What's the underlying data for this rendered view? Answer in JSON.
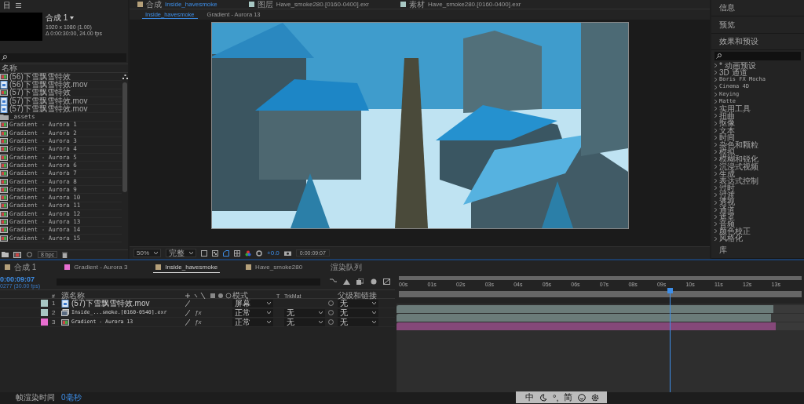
{
  "project": {
    "title": "目",
    "comp_name": "合成 1",
    "comp_size": "1920 x 1080 (1.00)",
    "comp_duration": "Δ 0:00:30:00, 24.00 fps",
    "column": "名称",
    "bpc": "8 bpc",
    "items": [
      {
        "name": "(56)下雪飘雪特效",
        "kind": "comp"
      },
      {
        "name": "(56)下雪飘雪特效.mov",
        "kind": "footage"
      },
      {
        "name": "(57)下雪飘雪特效",
        "kind": "comp"
      },
      {
        "name": "(57)下雪飘雪特效.mov",
        "kind": "footage"
      },
      {
        "name": "(57)下雪飘雪特效.mov",
        "kind": "footage"
      },
      {
        "name": "_assets",
        "kind": "folder"
      },
      {
        "name": "Gradient - Aurora 1",
        "kind": "comp"
      },
      {
        "name": "Gradient - Aurora 2",
        "kind": "comp"
      },
      {
        "name": "Gradient - Aurora 3",
        "kind": "comp"
      },
      {
        "name": "Gradient - Aurora 4",
        "kind": "comp"
      },
      {
        "name": "Gradient - Aurora 5",
        "kind": "comp"
      },
      {
        "name": "Gradient - Aurora 6",
        "kind": "comp"
      },
      {
        "name": "Gradient - Aurora 7",
        "kind": "comp"
      },
      {
        "name": "Gradient - Aurora 8",
        "kind": "comp"
      },
      {
        "name": "Gradient - Aurora 9",
        "kind": "comp"
      },
      {
        "name": "Gradient - Aurora 10",
        "kind": "comp"
      },
      {
        "name": "Gradient - Aurora 11",
        "kind": "comp"
      },
      {
        "name": "Gradient - Aurora 12",
        "kind": "comp"
      },
      {
        "name": "Gradient - Aurora 13",
        "kind": "comp"
      },
      {
        "name": "Gradient - Aurora 14",
        "kind": "comp"
      },
      {
        "name": "Gradient - Aurora 15",
        "kind": "comp"
      }
    ]
  },
  "viewer": {
    "tabs": [
      {
        "prefix": "合成",
        "label": "Inside_havesmoke",
        "selected": true
      },
      {
        "prefix": "图层",
        "label": "Have_smoke280.[0160-0400].exr",
        "selected": false
      },
      {
        "prefix": "素材",
        "label": "Have_smoke280.[0160-0400].exr",
        "selected": false
      }
    ],
    "breadcrumbs": [
      {
        "label": "Inside_havesmoke",
        "selected": true
      },
      {
        "label": "Gradient - Aurora 13",
        "selected": false
      }
    ],
    "zoom": "50%",
    "resolution": "完整",
    "exposure": "+0.0",
    "time": "0:00:09:07"
  },
  "right_panel": {
    "info": "信息",
    "preview": "预览",
    "effects_title": "效果和预设",
    "library": "库",
    "effects": [
      "* 动画预设",
      "3D 通道",
      "Boris FX Mocha",
      "Cinema 4D",
      "Keying",
      "Matte",
      "实用工具",
      "扭曲",
      "抠像",
      "文本",
      "时间",
      "杂色和颗粒",
      "模拟",
      "模糊和锐化",
      "沉浸式视频",
      "生成",
      "表达式控制",
      "过时",
      "过渡",
      "透视",
      "通道",
      "遮罩",
      "音频",
      "颜色校正",
      "风格化"
    ]
  },
  "timeline": {
    "tabs": [
      {
        "label": "合成 1",
        "color": "#b5a07a",
        "selected": false
      },
      {
        "label": "Gradient - Aurora 3",
        "color": "#e86ed0",
        "selected": false
      },
      {
        "label": "Inside_havesmoke",
        "color": "#b5a07a",
        "selected": true
      },
      {
        "label": "Have_smoke280",
        "color": "#b5a07a",
        "selected": false
      },
      {
        "label": "渲染队列",
        "selected": false
      }
    ],
    "time": "0:00:09:07",
    "frame_info": "0277 (30.00 fps)",
    "columns": {
      "number": "#",
      "source": "源名称",
      "mode": "模式",
      "t": "T",
      "trkmat": "TrkMat",
      "parent": "父级和链接"
    },
    "layers": [
      {
        "index": "1",
        "name": "(57)下雪飘雪特效.mov",
        "kind": "footage",
        "color": "#a8c8c4",
        "mode": "屏幕",
        "parent": "无",
        "level": 0.925
      },
      {
        "index": "2",
        "name": "Inside_...smoke.[0160-0540].exr",
        "kind": "sequence",
        "color": "#a8c8c4",
        "mode": "正常",
        "trkmat": "无",
        "effect_switch": "ƒx",
        "parent": "无",
        "level": 0.92
      },
      {
        "index": "3",
        "name": "Gradient - Aurora 13",
        "kind": "comp",
        "color": "#e86ed0",
        "mode": "正常",
        "trkmat": "无",
        "effect_switch": "ƒx",
        "parent": "无",
        "level": 0.93
      }
    ],
    "ruler": [
      "00s",
      "01s",
      "02s",
      "03s",
      "04s",
      "05s",
      "06s",
      "07s",
      "08s",
      "09s",
      "10s",
      "11s",
      "12s",
      "13s"
    ],
    "playhead": {
      "level": 0.67
    }
  },
  "status": {
    "label": "帧渲染时间",
    "value": "0毫秒"
  },
  "ime": {
    "mode": "中",
    "punct": "°,",
    "script": "简"
  }
}
